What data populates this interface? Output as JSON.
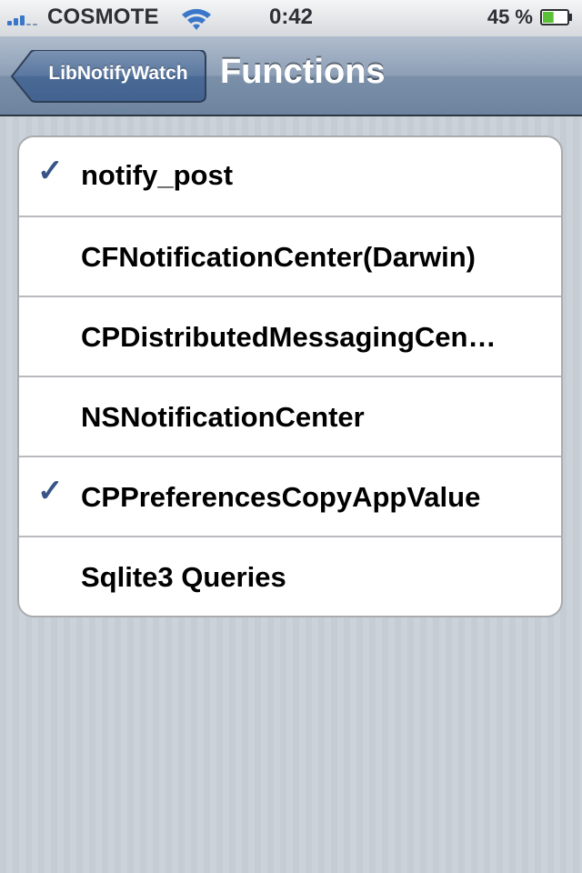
{
  "status_bar": {
    "carrier": "COSMOTE",
    "time": "0:42",
    "battery": "45 %",
    "signal_icon": "signal-bars-icon",
    "wifi_icon": "wifi-icon",
    "battery_icon": "battery-icon",
    "battery_level": 0.45
  },
  "navbar": {
    "back_label": "LibNotifyWatch",
    "title": "Functions"
  },
  "functions": [
    {
      "label": "notify_post",
      "checked": true
    },
    {
      "label": "CFNotificationCenter(Darwin)",
      "checked": false
    },
    {
      "label": "CPDistributedMessagingCen…",
      "checked": false
    },
    {
      "label": "NSNotificationCenter",
      "checked": false
    },
    {
      "label": "CPPreferencesCopyAppValue",
      "checked": true
    },
    {
      "label": "Sqlite3 Queries",
      "checked": false
    }
  ],
  "check_glyph": "✓",
  "colors": {
    "checkmark": "#385487",
    "navbar": "#6d84a0",
    "background": "#c5ccd4"
  }
}
